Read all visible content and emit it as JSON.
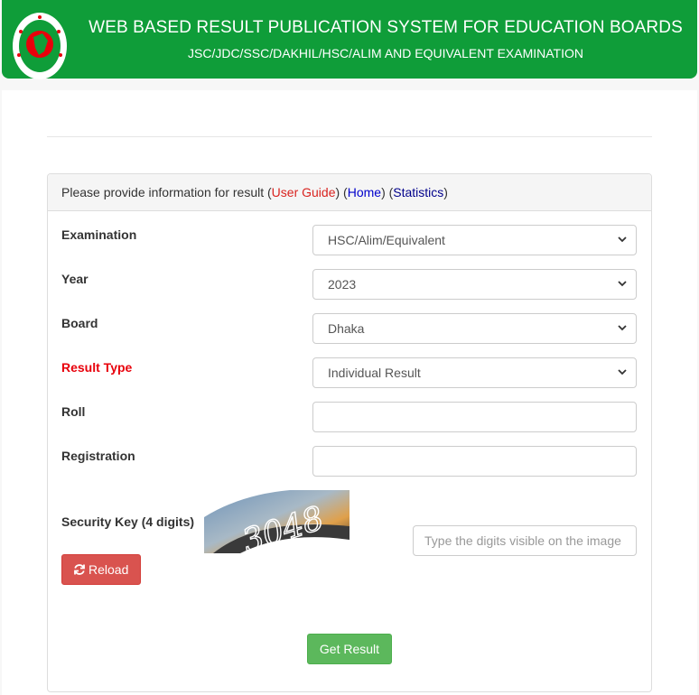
{
  "header": {
    "title": "WEB BASED RESULT PUBLICATION SYSTEM FOR EDUCATION BOARDS",
    "subtitle": "JSC/JDC/SSC/DAKHIL/HSC/ALIM AND EQUIVALENT EXAMINATION"
  },
  "panel": {
    "prompt": "Please provide information for result (",
    "user_guide": "User Guide",
    "mid1": ") (",
    "home": "Home",
    "mid2": ") (",
    "statistics": "Statistics",
    "end": ")"
  },
  "form": {
    "examination_label": "Examination",
    "examination_value": "HSC/Alim/Equivalent",
    "year_label": "Year",
    "year_value": "2023",
    "board_label": "Board",
    "board_value": "Dhaka",
    "result_type_label": "Result Type",
    "result_type_value": "Individual Result",
    "roll_label": "Roll",
    "roll_value": "",
    "registration_label": "Registration",
    "registration_value": "",
    "security_label": "Security Key (4 digits)",
    "captcha_text": "3048",
    "captcha_placeholder": "Type the digits visible on the image",
    "reload_label": "Reload",
    "submit_label": "Get Result"
  },
  "colors": {
    "header_green": "#0f9d39",
    "danger_red": "#d9534f",
    "success_green": "#5cb85c",
    "required_red": "#e8000b"
  },
  "icons": [
    "chevron-down-icon",
    "refresh-icon",
    "govt-seal-icon"
  ]
}
